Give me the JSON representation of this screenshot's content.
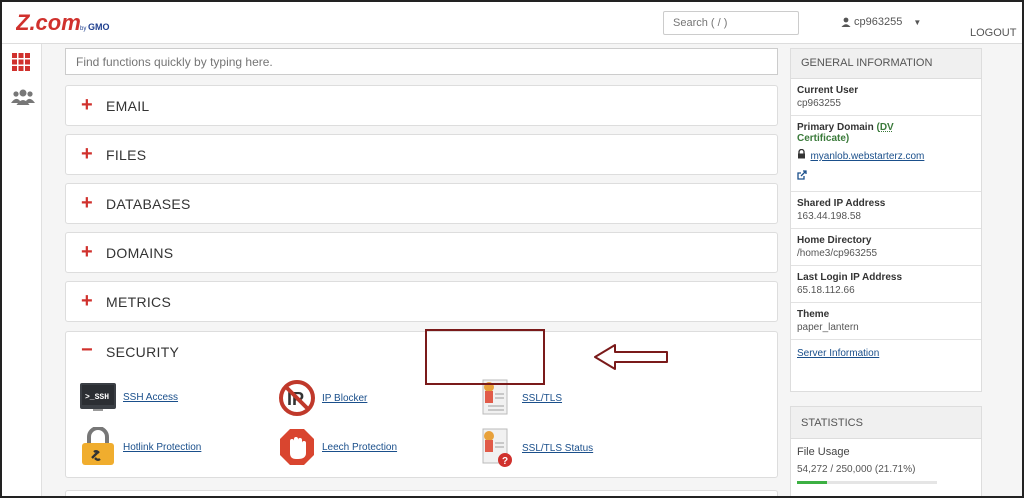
{
  "header": {
    "logo_text": "Z.com by GMO",
    "search_placeholder": "Search ( / )",
    "username": "cp963255",
    "logout_label": "LOGOUT"
  },
  "quick_find": {
    "placeholder": "Find functions quickly by typing here."
  },
  "sections": [
    {
      "sign": "+",
      "title": "EMAIL"
    },
    {
      "sign": "+",
      "title": "FILES"
    },
    {
      "sign": "+",
      "title": "DATABASES"
    },
    {
      "sign": "+",
      "title": "DOMAINS"
    },
    {
      "sign": "+",
      "title": "METRICS"
    },
    {
      "sign": "−",
      "title": "SECURITY"
    }
  ],
  "security_features": [
    {
      "label": "SSH Access",
      "icon": "ssh-terminal-icon"
    },
    {
      "label": "IP Blocker",
      "icon": "ip-blocker-icon"
    },
    {
      "label": "SSL/TLS",
      "icon": "ssl-certificate-icon"
    },
    {
      "label": "Hotlink Protection",
      "icon": "padlock-link-icon"
    },
    {
      "label": "Leech Protection",
      "icon": "stop-hand-icon"
    },
    {
      "label": "SSL/TLS Status",
      "icon": "ssl-status-icon"
    }
  ],
  "general_info": {
    "heading": "GENERAL INFORMATION",
    "current_user_label": "Current User",
    "current_user": "cp963255",
    "primary_domain_label": "Primary Domain",
    "cert_open": "(",
    "cert_dv": "DV",
    "cert_rest": "Certificate)",
    "primary_domain": "myanlob.webstarterz.com",
    "shared_ip_label": "Shared IP Address",
    "shared_ip": "163.44.198.58",
    "home_dir_label": "Home Directory",
    "home_dir": "/home3/cp963255",
    "last_login_label": "Last Login IP Address",
    "last_login": "65.18.112.66",
    "theme_label": "Theme",
    "theme": "paper_lantern",
    "server_info_link": "Server Information"
  },
  "statistics": {
    "heading": "STATISTICS",
    "file_usage_label": "File Usage",
    "file_usage_value": "54,272 / 250,000",
    "file_usage_pct": "(21.71%)",
    "file_usage_fraction": 0.2171
  },
  "colors": {
    "brand_red": "#d0312d",
    "link_blue": "#1a4f8b",
    "highlight_border": "#7a1a1a",
    "progress_green": "#3cb043"
  }
}
